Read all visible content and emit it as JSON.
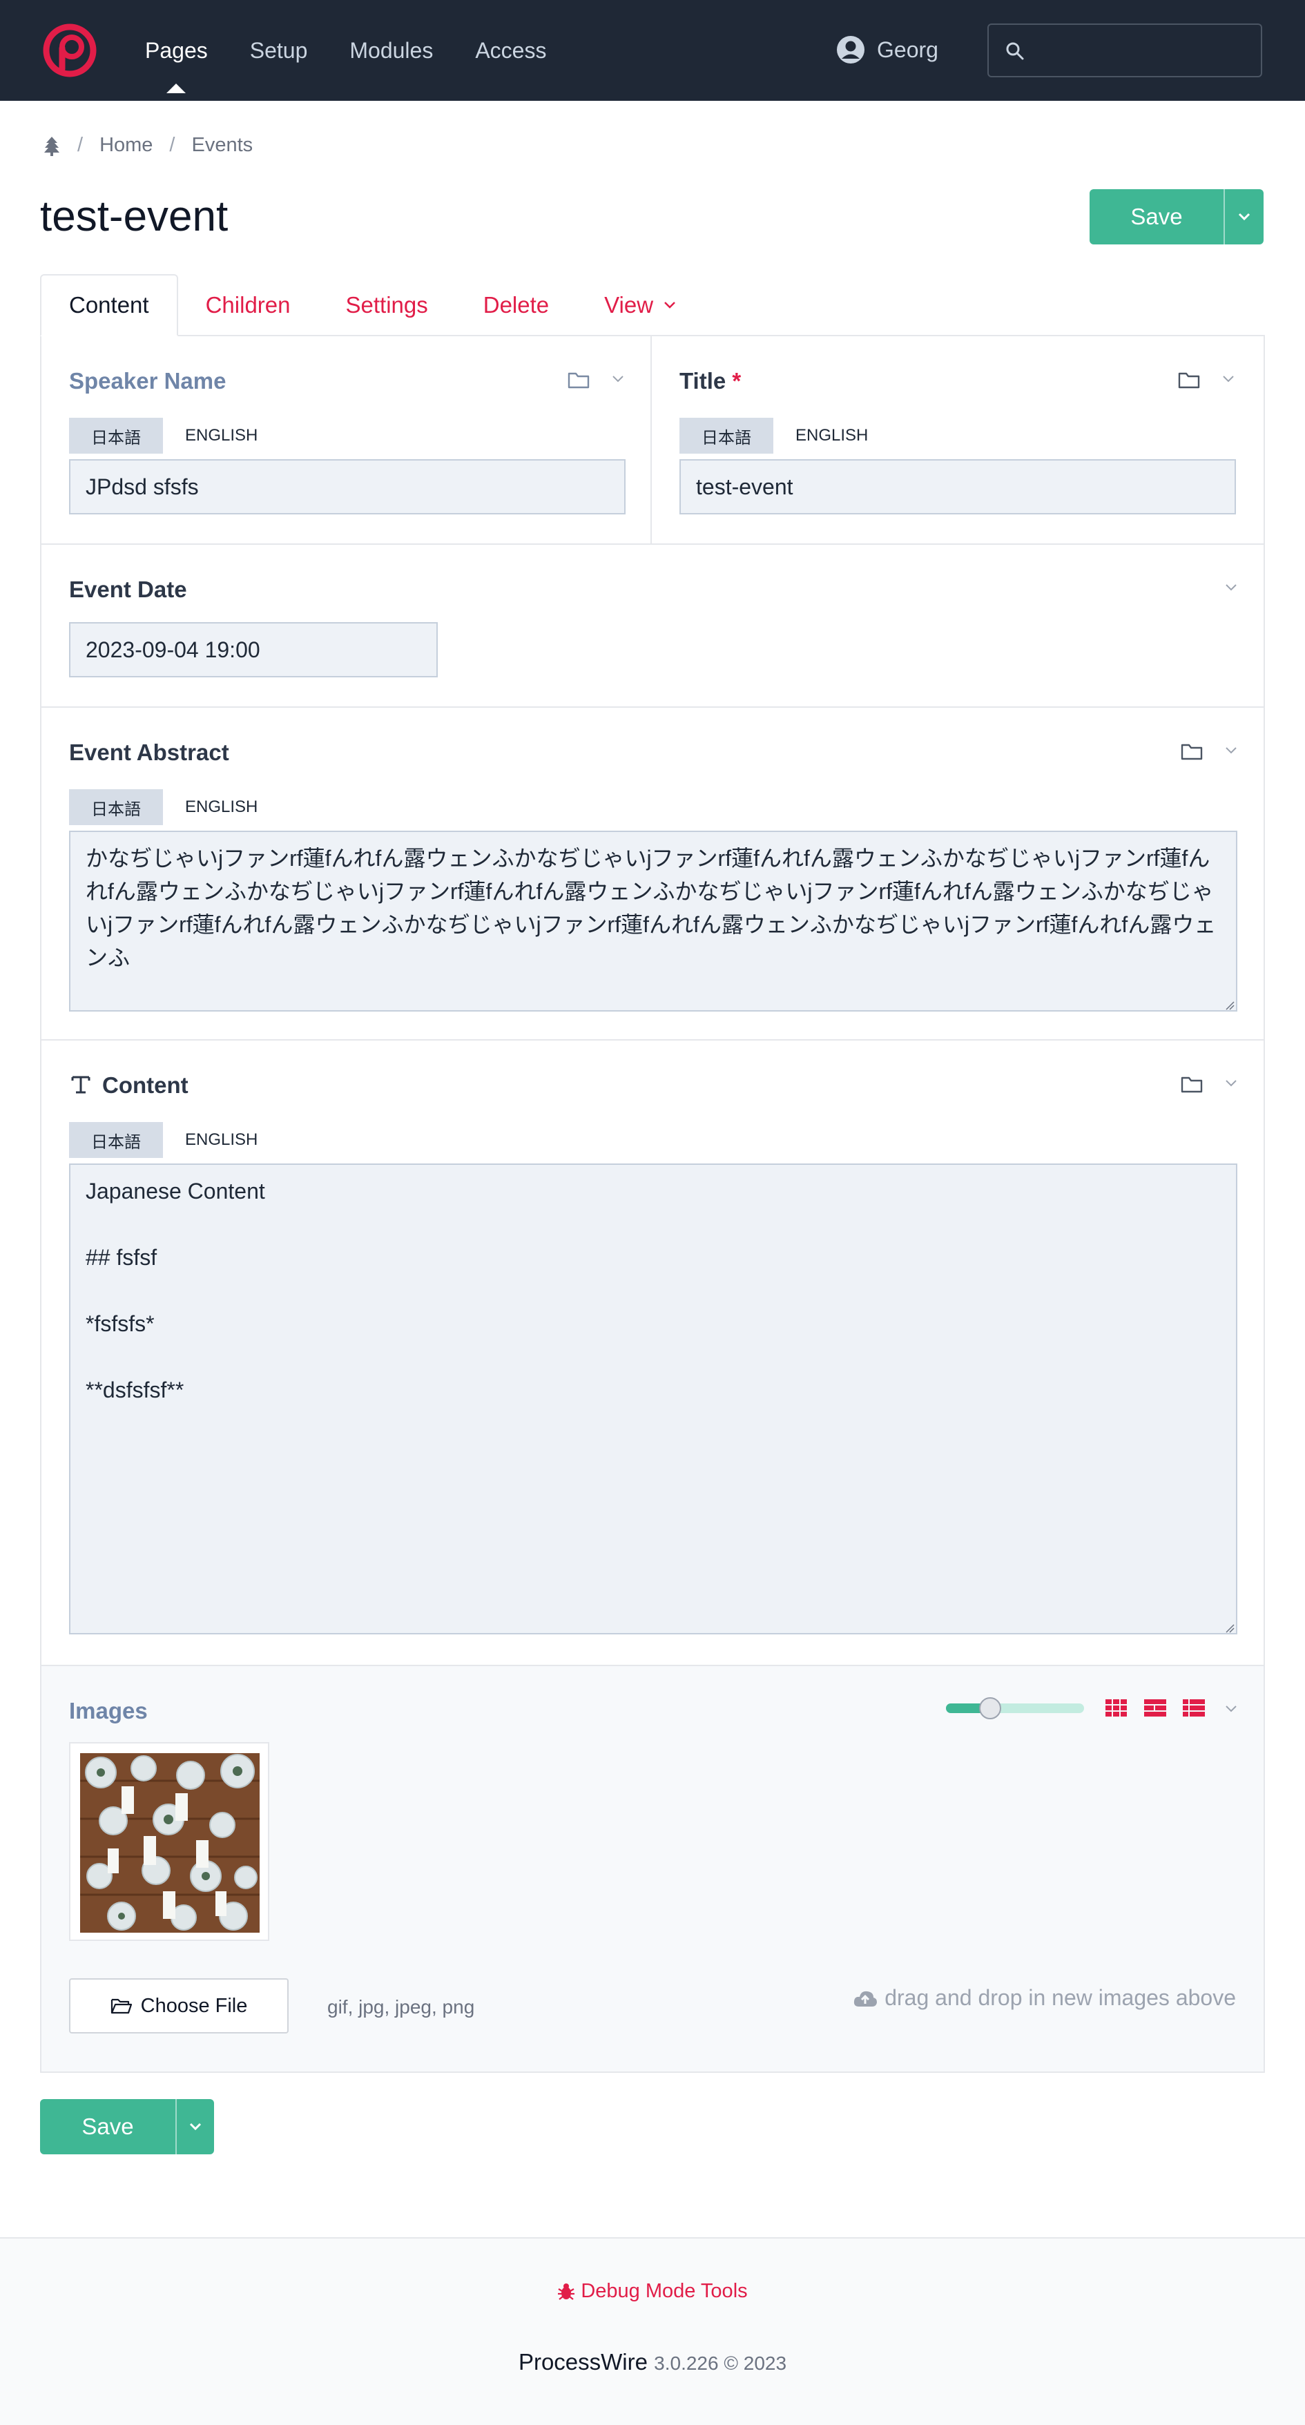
{
  "nav": {
    "items": [
      {
        "label": "Pages",
        "active": true
      },
      {
        "label": "Setup",
        "active": false
      },
      {
        "label": "Modules",
        "active": false
      },
      {
        "label": "Access",
        "active": false
      }
    ],
    "user": "Georg",
    "search_placeholder": ""
  },
  "breadcrumb": {
    "items": [
      "Home",
      "Events"
    ]
  },
  "page": {
    "title": "test-event"
  },
  "buttons": {
    "save": "Save"
  },
  "tabs": [
    {
      "label": "Content",
      "active": true
    },
    {
      "label": "Children",
      "active": false
    },
    {
      "label": "Settings",
      "active": false
    },
    {
      "label": "Delete",
      "active": false
    },
    {
      "label": "View",
      "active": false
    }
  ],
  "languages": [
    "日本語",
    "ENGLISH"
  ],
  "fields": {
    "speaker": {
      "label": "Speaker Name",
      "value": "JPdsd sfsfs"
    },
    "title": {
      "label": "Title",
      "required_mark": "*",
      "value": "test-event"
    },
    "event_date": {
      "label": "Event Date",
      "value": "2023-09-04 19:00"
    },
    "abstract": {
      "label": "Event Abstract",
      "value": "かなぢじゃいjファンrf蓮fんれfん露ウェンふかなぢじゃいjファンrf蓮fんれfん露ウェンふかなぢじゃいjファンrf蓮fんれfん露ウェンふかなぢじゃいjファンrf蓮fんれfん露ウェンふかなぢじゃいjファンrf蓮fんれfん露ウェンふかなぢじゃいjファンrf蓮fんれfん露ウェンふかなぢじゃいjファンrf蓮fんれfん露ウェンふかなぢじゃいjファンrf蓮fんれfん露ウェンふ"
    },
    "content": {
      "label": "Content",
      "value": "Japanese Content\n\n## fsfsf\n\n*fsfsfs*\n\n**dsfsfsf**"
    },
    "images": {
      "label": "Images",
      "size_slider": 0.32,
      "choose_file": "Choose File",
      "allowed_types": "gif, jpg, jpeg, png",
      "drag_hint": "drag and drop in new images above"
    }
  },
  "footer": {
    "debug": "Debug Mode Tools",
    "product": "ProcessWire",
    "version": "3.0.226 © 2023"
  },
  "colors": {
    "topbar": "#1f2836",
    "accent": "#e11d48",
    "save": "#3fb794",
    "input_bg": "#eef2f7"
  }
}
